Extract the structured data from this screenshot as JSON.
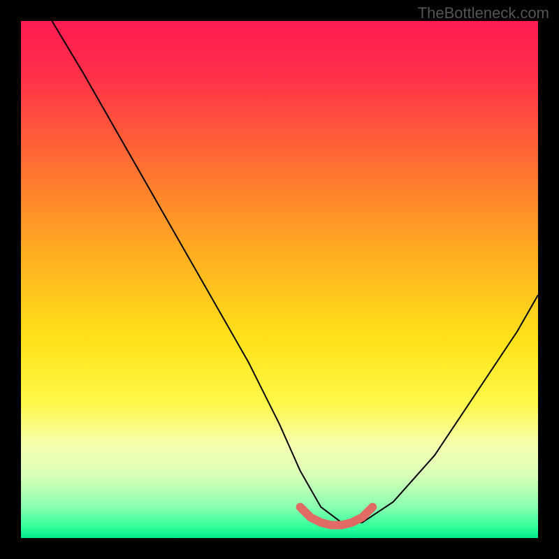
{
  "watermark": "TheBottleneck.com",
  "chart_data": {
    "type": "line",
    "title": "",
    "xlabel": "",
    "ylabel": "",
    "xlim": [
      0,
      100
    ],
    "ylim": [
      0,
      100
    ],
    "series": [
      {
        "name": "black-curve",
        "x": [
          6,
          12,
          20,
          28,
          36,
          44,
          50,
          54,
          58,
          62,
          66,
          72,
          80,
          88,
          96,
          100
        ],
        "y": [
          100,
          90,
          76,
          62,
          48,
          34,
          22,
          13,
          6,
          3,
          3,
          7,
          16,
          28,
          40,
          47
        ]
      },
      {
        "name": "valley-highlight",
        "x": [
          54,
          56,
          58,
          60,
          62,
          64,
          66,
          68
        ],
        "y": [
          6,
          4,
          3,
          2.5,
          2.5,
          3,
          4,
          6
        ]
      }
    ]
  }
}
